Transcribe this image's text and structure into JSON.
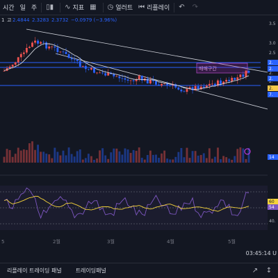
{
  "toolbar": {
    "interval_label": "시간",
    "interval_value": "일",
    "chart_type_label": "주",
    "indicators_label": "지표",
    "alert_label": "얼러트",
    "replay_label": "리플레이"
  },
  "legend": {
    "prefix": "1",
    "high_label": "고",
    "high_value": "2.4844",
    "low_value": "2.3283",
    "close_value": "2.3732",
    "change": "−0.0979 (−3.96%)"
  },
  "price_axis": {
    "ticks": [
      "3.5",
      "3.0",
      "2.5",
      "2.",
      "2.",
      "2.",
      "2.",
      "2.",
      "2."
    ],
    "labels": [
      "2.",
      "2.",
      "2.",
      "2.",
      "7."
    ],
    "volume_label": "14",
    "rsi_values": [
      "60",
      "54"
    ],
    "rsi_ticks": [
      "40."
    ]
  },
  "annotation": {
    "label": "매매구간"
  },
  "time_axis": {
    "labels": [
      "5",
      "2월",
      "3월",
      "4월",
      "5월"
    ]
  },
  "clock": "03:45:14 U",
  "bottom_tabs": [
    "리플레이 트레이딩 패널",
    "트레이딩패널"
  ],
  "colors": {
    "up": "#ef5350",
    "down": "#2962ff",
    "ma": "#d1d4dc",
    "rsi": "#7e57c2",
    "rsi_ma": "#f5d33a",
    "zone": "#9c27b0",
    "support": "#2962ff"
  },
  "icons": [
    "candles-icon",
    "chart-style-icon",
    "indicators-icon",
    "alert-icon",
    "replay-icon",
    "undo-icon",
    "redo-icon",
    "line-tool-icon",
    "measure-icon",
    "settings-icon"
  ]
}
